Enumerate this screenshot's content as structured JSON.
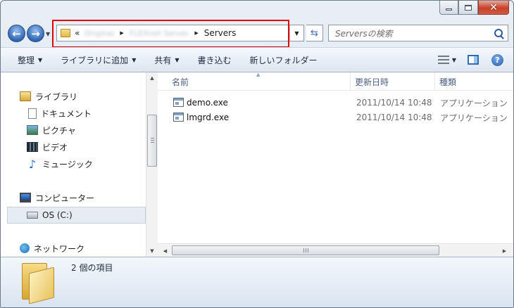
{
  "window": {
    "caption": {
      "minimize": "minimize",
      "maximize": "maximize",
      "close": "✕"
    }
  },
  "address": {
    "overflow": "«",
    "crumbs": [
      "Original",
      "FLEXnet Server"
    ],
    "current": "Servers"
  },
  "search": {
    "placeholder": "Serversの検索"
  },
  "toolbar": {
    "organize": "整理",
    "add_to_library": "ライブラリに追加",
    "share": "共有",
    "burn": "書き込む",
    "new_folder": "新しいフォルダー"
  },
  "sidebar": {
    "libraries": "ライブラリ",
    "documents": "ドキュメント",
    "pictures": "ピクチャ",
    "videos": "ビデオ",
    "music": "ミュージック",
    "computer": "コンピューター",
    "os_drive": "OS (C:)",
    "network": "ネットワーク"
  },
  "columns": {
    "name": "名前",
    "date": "更新日時",
    "type": "種類"
  },
  "files": [
    {
      "name": "demo.exe",
      "date": "2011/10/14 10:48",
      "type": "アプリケーション"
    },
    {
      "name": "lmgrd.exe",
      "date": "2011/10/14 10:48",
      "type": "アプリケーション"
    }
  ],
  "details": {
    "item_count": "2 個の項目"
  },
  "colors": {
    "highlight": "#e00000",
    "accent": "#2f66b4"
  }
}
